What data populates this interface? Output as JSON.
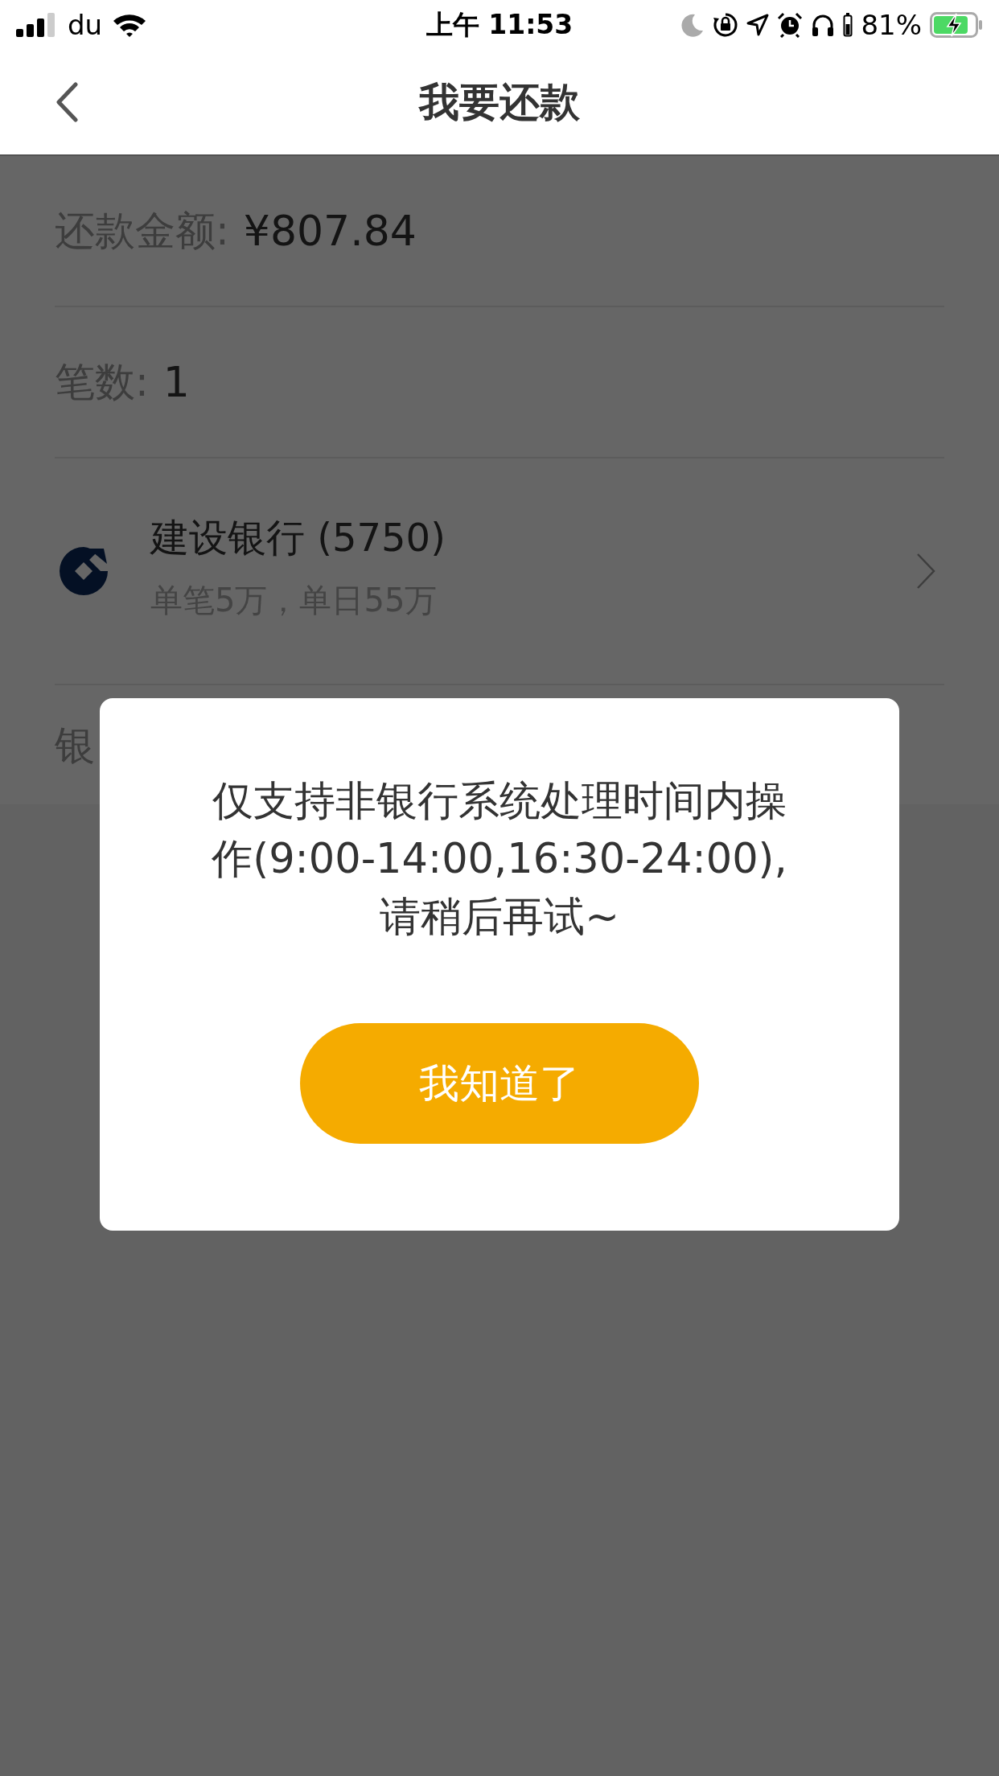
{
  "status_bar": {
    "carrier": "du",
    "time": "上午 11:53",
    "battery": "81%"
  },
  "header": {
    "title": "我要还款"
  },
  "form": {
    "amount": {
      "label": "还款金额:",
      "value": "¥807.84"
    },
    "count": {
      "label": "笔数:",
      "value": "1"
    },
    "bank": {
      "name": "建设银行 (5750)",
      "limit": "单笔5万，单日55万"
    },
    "next_row_label": "银"
  },
  "dialog": {
    "message": "仅支持非银行系统处理时间内操作(9:00-14:00,16:30-24:00),请稍后再试~",
    "button": "我知道了"
  }
}
